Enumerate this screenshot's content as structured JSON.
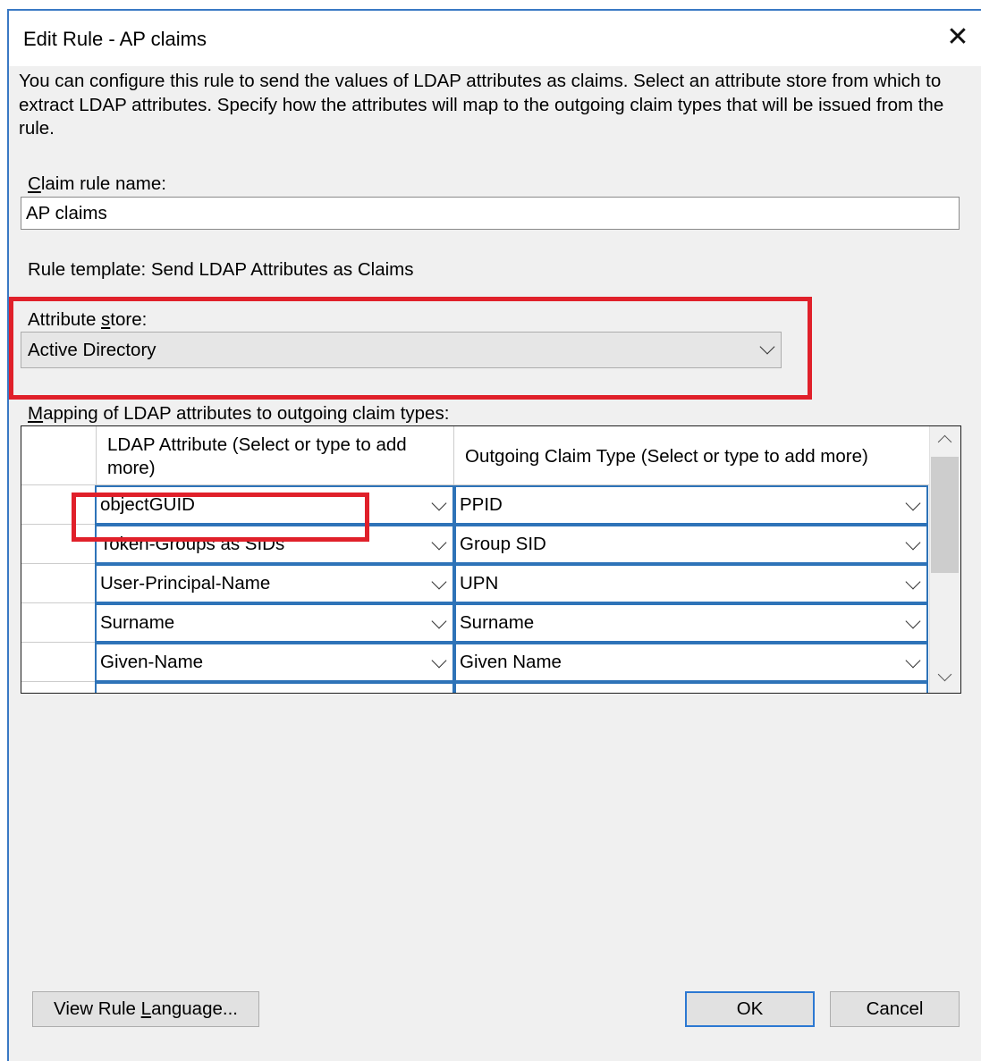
{
  "window": {
    "title": "Edit Rule - AP claims"
  },
  "description": "You can configure this rule to send the values of LDAP attributes as claims. Select an attribute store from which to extract LDAP attributes. Specify how the attributes will map to the outgoing claim types that will be issued from the rule.",
  "claim_rule_name": {
    "label_key": "C",
    "label_rest": "laim rule name:",
    "value": "AP claims"
  },
  "rule_template": "Rule template: Send LDAP Attributes as Claims",
  "attribute_store": {
    "label_pre": "Attribute ",
    "label_key": "s",
    "label_post": "tore:",
    "value": "Active Directory"
  },
  "mapping": {
    "label_key": "M",
    "label_rest": "apping of LDAP attributes to outgoing claim types:",
    "columns": {
      "ldap": "LDAP Attribute (Select or type to add more)",
      "claim": "Outgoing Claim Type (Select or type to add more)"
    },
    "rows": [
      {
        "ldap": "objectGUID",
        "claim": "PPID"
      },
      {
        "ldap": "Token-Groups as SIDs",
        "claim": "Group SID"
      },
      {
        "ldap": "User-Principal-Name",
        "claim": "UPN"
      },
      {
        "ldap": "Surname",
        "claim": "Surname"
      },
      {
        "ldap": "Given-Name",
        "claim": "Given Name"
      }
    ]
  },
  "buttons": {
    "view_rule_language": {
      "pre": "View Rule ",
      "key": "L",
      "post": "anguage..."
    },
    "ok": "OK",
    "cancel": "Cancel"
  },
  "colors": {
    "highlight": "#e0202a",
    "accent": "#2e73b8"
  }
}
